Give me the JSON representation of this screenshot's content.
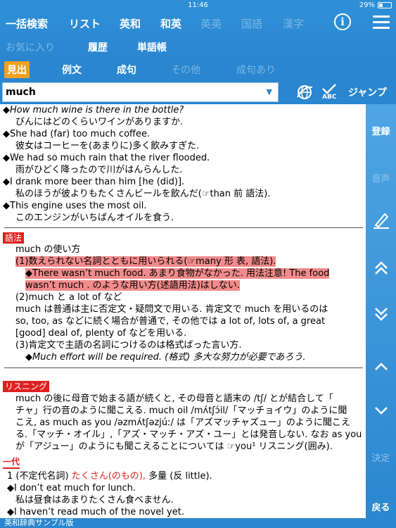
{
  "status": {
    "time": "11:46",
    "battery": "29%",
    "battery_level": 0.29
  },
  "topnav": {
    "row1": [
      {
        "label": "一括検索",
        "dim": false
      },
      {
        "label": "リスト",
        "dim": false
      },
      {
        "label": "英和",
        "dim": false
      },
      {
        "label": "和英",
        "dim": false
      },
      {
        "label": "英英",
        "dim": true
      },
      {
        "label": "国語",
        "dim": true
      },
      {
        "label": "漢字",
        "dim": true
      }
    ],
    "row2": [
      {
        "label": "お気に入り",
        "dim": true
      },
      {
        "label": "履歴",
        "dim": false
      },
      {
        "label": "単語帳",
        "dim": false
      }
    ],
    "info_icon": "info-icon",
    "menu_icon": "hamburger-menu-icon"
  },
  "tabs": [
    {
      "label": "見出",
      "active": true,
      "dim": false
    },
    {
      "label": "例文",
      "active": false,
      "dim": false
    },
    {
      "label": "成句",
      "active": false,
      "dim": false
    },
    {
      "label": "その他",
      "active": false,
      "dim": true
    },
    {
      "label": "成句あり",
      "active": false,
      "dim": true
    }
  ],
  "search": {
    "value": "much",
    "jump_label": "ジャンプ",
    "abc_label": "ABC"
  },
  "content": {
    "ex1_en": "How  much  wine is there in the bottle?",
    "ex1_ja": "びんにはどのくらいワインがありますか.",
    "ex2_en": "She had (far)  too  much  coffee.",
    "ex2_ja": "彼女はコーヒーを(あまりに)多く飲みすぎた.",
    "ex3_en": "We had  so  much  rain that the river flooded.",
    "ex3_ja": "雨がひどく降ったので川がはんらんした.",
    "ex4_en": "I drank  more  beer  than  him [he (did)].",
    "ex4_ja": "私のほうが彼よりもたくさんビールを飲んだ(☞than 前 語法).",
    "ex5_en": "This engine uses the  most  oil.",
    "ex5_ja": "このエンジンがいちばんオイルを食う.",
    "usage_label": "語法",
    "usage_title": "much の使い方",
    "usage_1": "(1)数えられない名詞とともに用いられる(☞many 形 表, 語法).",
    "usage_1_ex_a": "There wasn’t  much  food. あまり食物がなかった.  用法注意!  The food",
    "usage_1_ex_b": "wasn’t  much . のような用い方(述語用法)はしない.",
    "usage_2": "(2)much と a lot of など",
    "usage_2_a": "much は普通は主に否定文・疑問文で用いる. 肯定文で much を用いるのは",
    "usage_2_b": "so, too, as などに続く場合が普通で, その他では a lot of, lots of, a great",
    "usage_2_c": "[good] deal of, plenty of などを用いる.",
    "usage_3": "(3)肯定文で主語の名詞につけるのは格式ばった言い方.",
    "usage_3_ex": "Much  effort will be required. (格式) 多大な努力が必要であろう.",
    "listen_label": "リスニング",
    "listen_a": "much の後に母音で始まる語が続くと, その母音と語末の /tʃ/ とが結合して「",
    "listen_b": "チャ」行の音のように聞こえる. much oil /mʌ́tʃɔ́il/「マッチョイウ」のように聞",
    "listen_c": "こえ, as much as you /əzmʌ́tʃəzjúː/ は「アズマッチャズュー」のように聞こえ",
    "listen_d": "る.「マッチ・オイル」,「アズ・マッチ・アズ・ユー」とは発音しない. なお as you",
    "listen_e": "が「アジュー」のようにも聞こえることについては ☞you¹ リスニング(囲み).",
    "pron_label": "一代",
    "pron_1a": "1 (不定代名詞)",
    "pron_1b": "たくさん(のもの),",
    "pron_1c": " 多量 (反 little).",
    "pron_ex1_en": "I don’t eat  much  for lunch.",
    "pron_ex1_ja": "私は昼食はあまりたくさん食べません.",
    "pron_ex2_en": "I haven’t read  much  of the novel yet."
  },
  "sidebar": {
    "register": "登録",
    "audio": "音声",
    "decide": "決定",
    "back": "戻る"
  },
  "footer": "英和辞典サンプル版",
  "colors": {
    "primary": "#2a86cf",
    "accent": "#f0a020",
    "highlight": "#f28b8b",
    "label_red": "#e02020"
  }
}
